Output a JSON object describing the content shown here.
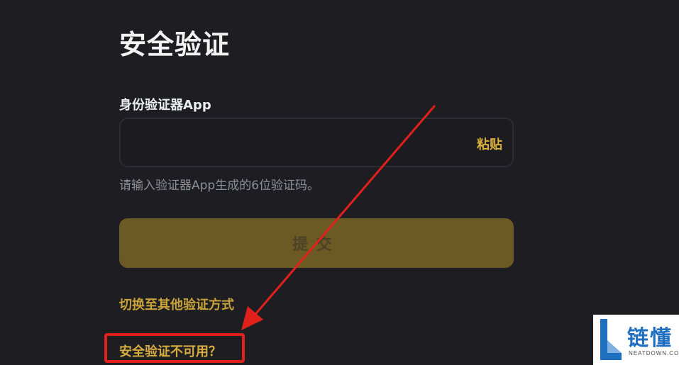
{
  "page": {
    "title": "安全验证"
  },
  "authenticator": {
    "label": "身份验证器App",
    "input_value": "",
    "input_placeholder": "",
    "paste_label": "粘贴",
    "hint": "请输入验证器App生成的6位验证码。"
  },
  "submit": {
    "label": "提交"
  },
  "links": {
    "switch_method": "切换至其他验证方式",
    "security_unavailable": "安全验证不可用？"
  },
  "annotation": {
    "color": "#e0201b"
  },
  "watermark": {
    "name": "链懂",
    "domain": "NEATDOWN.COM"
  },
  "colors": {
    "background": "#1e1e22",
    "accent": "#d7ad3e",
    "submit_disabled": "#6b5a23"
  }
}
